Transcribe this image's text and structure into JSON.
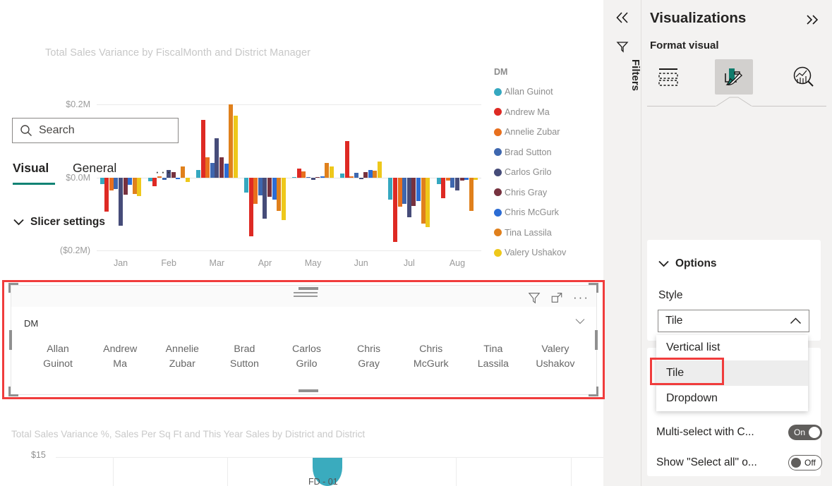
{
  "chart_data": {
    "type": "bar",
    "title": "Total Sales Variance by FiscalMonth and District Manager",
    "xlabel": "",
    "ylabel": "",
    "grid": true,
    "legend_position": "right",
    "legend_title": "DM",
    "categories": [
      "Jan",
      "Feb",
      "Mar",
      "Apr",
      "May",
      "Jun",
      "Jul",
      "Aug"
    ],
    "ylim": [
      -0.2,
      0.2
    ],
    "ytick_labels": [
      "$0.2M",
      "$0.0M",
      "($0.2M)"
    ],
    "ytick_values": [
      0.2,
      0.0,
      -0.2
    ],
    "series": [
      {
        "name": "Allan Guinot",
        "color": "#35A8C0",
        "values": [
          -0.018,
          -0.01,
          0.022,
          -0.04,
          0.002,
          0.012,
          -0.06,
          -0.018
        ]
      },
      {
        "name": "Andrew Ma",
        "color": "#DE2A24",
        "values": [
          -0.092,
          -0.024,
          0.158,
          -0.16,
          0.025,
          0.1,
          -0.175,
          -0.055
        ]
      },
      {
        "name": "Annelie Zubar",
        "color": "#E8701E",
        "values": [
          -0.034,
          0.004,
          0.055,
          -0.072,
          0.018,
          0.003,
          -0.078,
          -0.008
        ]
      },
      {
        "name": "Brad Sutton",
        "color": "#3E67AF",
        "values": [
          -0.03,
          -0.006,
          0.04,
          -0.048,
          0.002,
          0.014,
          -0.072,
          -0.026
        ]
      },
      {
        "name": "Carlos Grilo",
        "color": "#464C79",
        "values": [
          -0.13,
          0.022,
          0.108,
          -0.112,
          -0.006,
          -0.004,
          -0.108,
          -0.034
        ]
      },
      {
        "name": "Chris Gray",
        "color": "#77323F",
        "values": [
          -0.046,
          0.016,
          0.055,
          -0.052,
          0.002,
          0.016,
          -0.076,
          -0.008
        ]
      },
      {
        "name": "Chris McGurk",
        "color": "#2C6CD4",
        "values": [
          -0.02,
          -0.002,
          0.038,
          -0.06,
          0.004,
          0.022,
          -0.064,
          -0.006
        ]
      },
      {
        "name": "Tina Lassila",
        "color": "#E0801C",
        "values": [
          -0.044,
          0.03,
          0.2,
          -0.09,
          0.04,
          0.02,
          -0.125,
          -0.09
        ]
      },
      {
        "name": "Valery Ushakov",
        "color": "#EEC81B",
        "values": [
          -0.05,
          -0.012,
          0.17,
          -0.115,
          0.03,
          0.045,
          -0.135,
          -0.005
        ]
      }
    ]
  },
  "bottom_chart": {
    "title": "Total Sales Variance %, Sales Per Sq Ft and This Year Sales by District and District",
    "ytick_label": "$15",
    "bubble_label": "FD - 01",
    "bubble_color": "#3aabbe"
  },
  "slicer": {
    "field_label": "DM",
    "items": [
      "Allan Guinot",
      "Andrew Ma",
      "Annelie Zubar",
      "Brad Sutton",
      "Carlos Grilo",
      "Chris Gray",
      "Chris McGurk",
      "Tina Lassila",
      "Valery Ushakov"
    ],
    "tools": {
      "filter": "filter-icon",
      "focus": "focus-mode-icon",
      "more": "more-options-icon"
    }
  },
  "filters_rail": {
    "expand_label": "«",
    "title": "Filters",
    "icon": "filter-icon"
  },
  "pane": {
    "title": "Visualizations",
    "collapse_label": "»",
    "subtitle": "Format visual",
    "icons": [
      {
        "name": "build-visual-icon",
        "label": "Build visual"
      },
      {
        "name": "format-visual-icon",
        "label": "Format visual"
      },
      {
        "name": "analytics-icon",
        "label": "Analytics"
      }
    ],
    "search": {
      "placeholder": "Search",
      "value": "",
      "icon": "search-icon"
    },
    "tabs": [
      {
        "label": "Visual",
        "selected": true
      },
      {
        "label": "General",
        "selected": false
      }
    ],
    "tabs_more": "···",
    "section": {
      "label": "Slicer settings",
      "expanded": true
    },
    "options": {
      "label": "Options",
      "style_label": "Style",
      "style_value": "Tile",
      "style_choices": [
        "Vertical list",
        "Tile",
        "Dropdown"
      ],
      "style_highlighted": "Tile"
    },
    "settings": [
      {
        "label": "Multi-select with C...",
        "state": "On"
      },
      {
        "label": "Show \"Select all\" o...",
        "state": "Off"
      }
    ]
  },
  "colors": {
    "accent_teal": "#118374",
    "highlight_red": "#f03c3c",
    "pane_bg": "#f3f2f1"
  }
}
